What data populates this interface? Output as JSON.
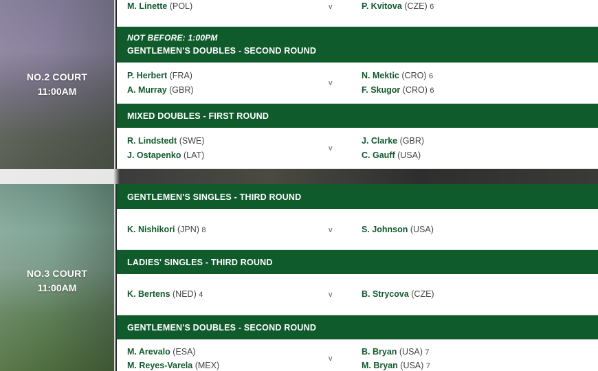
{
  "courts": [
    {
      "name": "NO.2 COURT",
      "time": "11:00AM",
      "top_match": {
        "left": [
          {
            "name": "M. Linette",
            "country": "(POL)",
            "seed": ""
          }
        ],
        "vs": "v",
        "right": [
          {
            "name": "P. Kvitova",
            "country": "(CZE)",
            "seed": "6"
          }
        ]
      },
      "events": [
        {
          "not_before": "NOT BEFORE: 1:00PM",
          "title": "GENTLEMEN'S DOUBLES - SECOND ROUND",
          "match": {
            "left": [
              {
                "name": "P. Herbert",
                "country": "(FRA)",
                "seed": ""
              },
              {
                "name": "A. Murray",
                "country": "(GBR)",
                "seed": ""
              }
            ],
            "vs": "v",
            "right": [
              {
                "name": "N. Mektic",
                "country": "(CRO)",
                "seed": "6"
              },
              {
                "name": "F. Skugor",
                "country": "(CRO)",
                "seed": "6"
              }
            ]
          }
        },
        {
          "not_before": "",
          "title": "MIXED DOUBLES - FIRST ROUND",
          "match": {
            "left": [
              {
                "name": "R. Lindstedt",
                "country": "(SWE)",
                "seed": ""
              },
              {
                "name": "J. Ostapenko",
                "country": "(LAT)",
                "seed": ""
              }
            ],
            "vs": "v",
            "right": [
              {
                "name": "J. Clarke",
                "country": "(GBR)",
                "seed": ""
              },
              {
                "name": "C. Gauff",
                "country": "(USA)",
                "seed": ""
              }
            ]
          }
        }
      ]
    },
    {
      "name": "NO.3 COURT",
      "time": "11:00AM",
      "events": [
        {
          "title": "GENTLEMEN'S SINGLES - THIRD ROUND",
          "match": {
            "left": [
              {
                "name": "K. Nishikori",
                "country": "(JPN)",
                "seed": "8"
              }
            ],
            "vs": "v",
            "right": [
              {
                "name": "S. Johnson",
                "country": "(USA)",
                "seed": ""
              }
            ]
          }
        },
        {
          "title": "LADIES' SINGLES - THIRD ROUND",
          "match": {
            "left": [
              {
                "name": "K. Bertens",
                "country": "(NED)",
                "seed": "4"
              }
            ],
            "vs": "v",
            "right": [
              {
                "name": "B. Strycova",
                "country": "(CZE)",
                "seed": ""
              }
            ]
          }
        },
        {
          "title": "GENTLEMEN'S DOUBLES - SECOND ROUND",
          "match": {
            "left": [
              {
                "name": "M. Arevalo",
                "country": "(ESA)",
                "seed": ""
              },
              {
                "name": "M. Reyes-Varela",
                "country": "(MEX)",
                "seed": ""
              }
            ],
            "vs": "v",
            "right": [
              {
                "name": "B. Bryan",
                "country": "(USA)",
                "seed": "7"
              },
              {
                "name": "M. Bryan",
                "country": "(USA)",
                "seed": "7"
              }
            ]
          }
        }
      ]
    }
  ],
  "colors": {
    "header_green": "#0f5b2c",
    "player_name_green": "#0f5b2c",
    "row_background": "#ffffff",
    "court_label_text": "#ffffff"
  }
}
